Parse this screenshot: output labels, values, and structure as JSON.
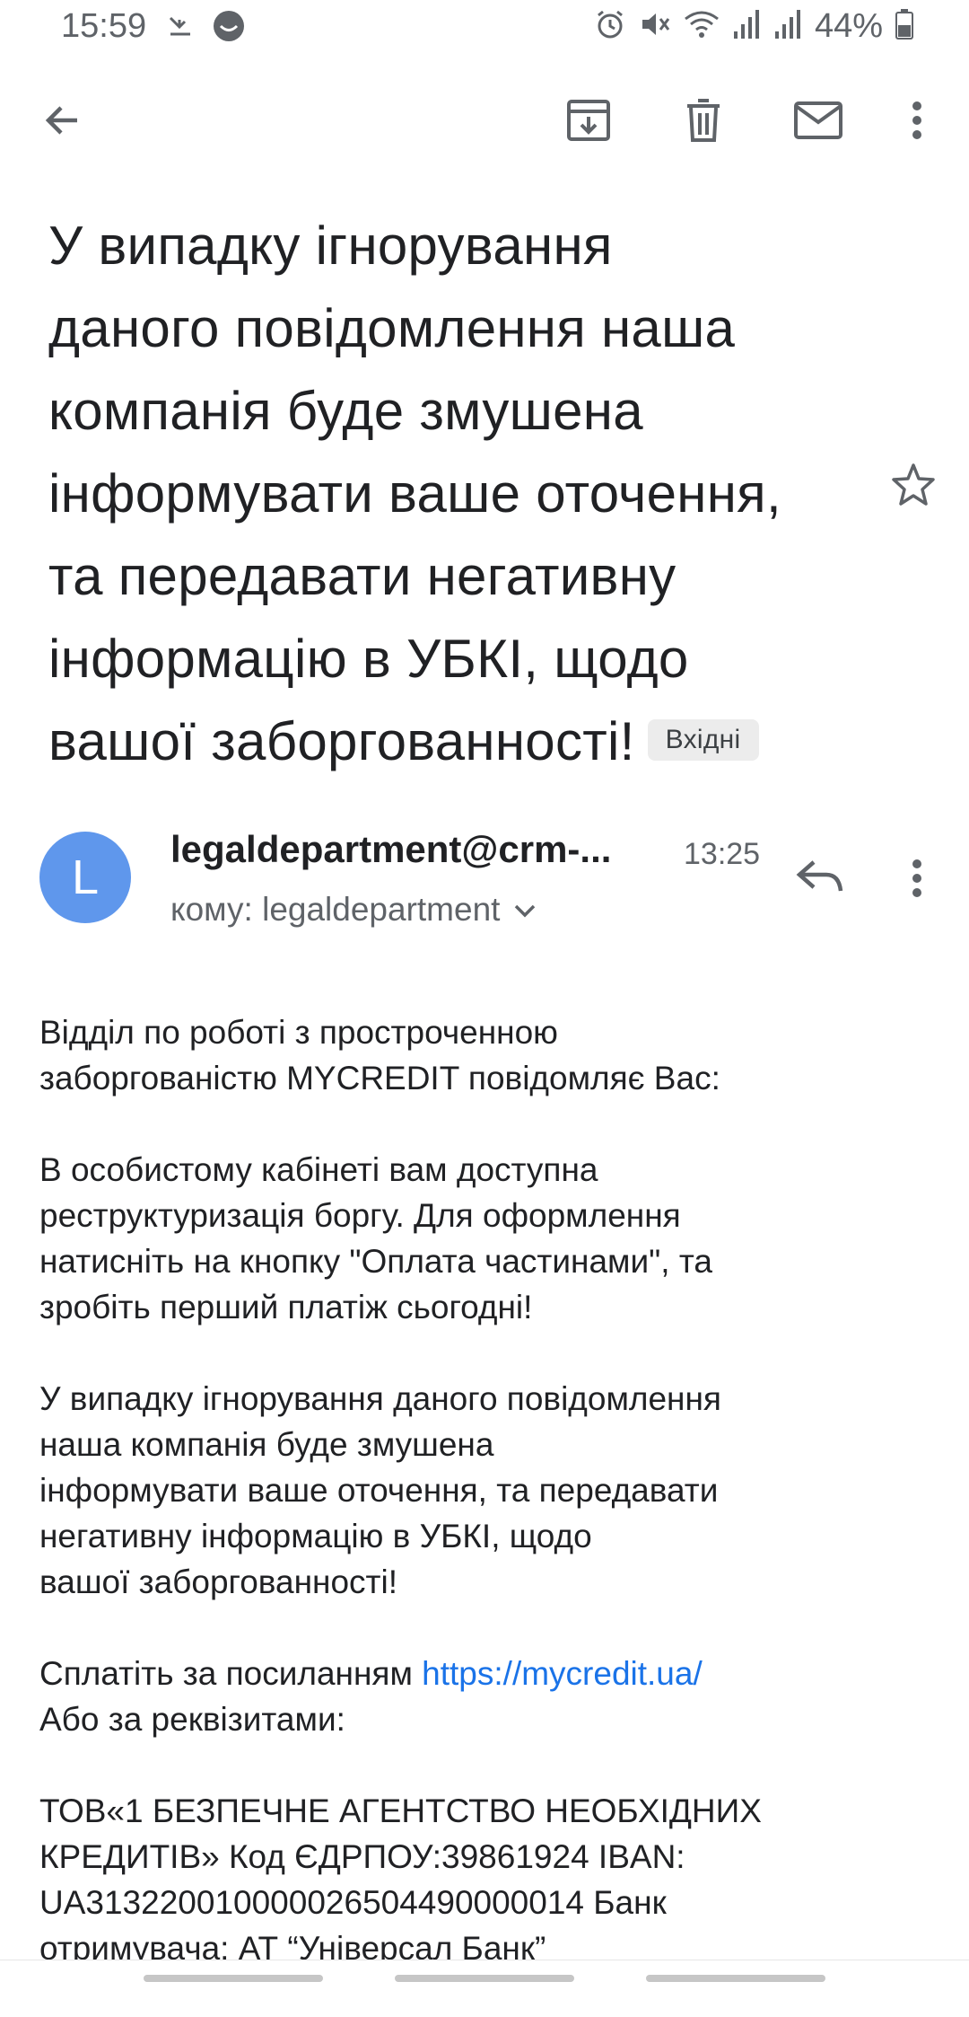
{
  "status": {
    "time": "15:59",
    "battery": "44%",
    "icons": [
      "missed-call-icon",
      "app-notification-icon",
      "alarm-icon",
      "mute-icon",
      "wifi-icon",
      "signal-icon",
      "signal-icon",
      "battery-icon"
    ]
  },
  "toolbar": {
    "back": "back-arrow-icon",
    "archive": "archive-icon",
    "delete": "trash-icon",
    "mark_unread": "mail-icon",
    "more": "more-vert-icon"
  },
  "email": {
    "subject_lines": [
      "У випадку ігнорування",
      "даного повідомлення наша",
      "компанія буде змушена",
      "інформувати ваше оточення,",
      "та передавати негативну",
      "інформацію в УБКІ, щодо",
      "вашої заборгованності!"
    ],
    "label": "Вхідні",
    "sender": {
      "avatar_letter": "L",
      "address": "legaldepartment@crm-...",
      "time": "13:25",
      "recipient": "кому: legaldepartment"
    },
    "body": {
      "p1": [
        "Відділ по роботі з простроченною",
        "заборгованістю MYCREDIT повідомляє Вас:"
      ],
      "p2": [
        "В особистому кабінеті вам доступна",
        "реструктуризація боргу. Для оформлення",
        "натисніть на кнопку \"Оплата частинами\", та",
        "зробіть перший платіж сьогодні!"
      ],
      "p3": [
        "У випадку ігнорування даного повідомлення",
        "наша компанія буде змушена",
        "інформувати ваше оточення, та передавати",
        "негативну інформацію в УБКІ, щодо",
        "вашої заборгованності!"
      ],
      "pay_prefix": "Сплатіть за посиланням ",
      "pay_link": "https://mycredit.ua/",
      "pay_alt": "Або за реквізитами:",
      "p5": [
        "ТОВ«1 БЕЗПЕЧНЕ АГЕНТСТВО НЕОБХІДНИХ",
        "КРЕДИТІВ» Код ЄДРПОУ:39861924 IBAN:",
        "UA313220010000026504490000014 Банк",
        "отримувача: АТ “Універсал Банк”"
      ]
    }
  }
}
